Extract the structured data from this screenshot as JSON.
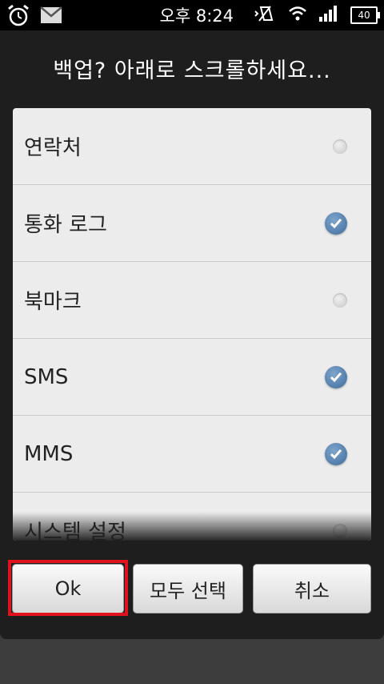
{
  "statusbar": {
    "time": "오후 8:24",
    "battery": "40",
    "left_icons": [
      "alarm-icon",
      "gmail-icon"
    ],
    "right_icons": [
      "vibrate-off-icon",
      "wifi-icon",
      "signal-icon",
      "battery-icon"
    ]
  },
  "dialog": {
    "title": "백업? 아래로 스크롤하세요..."
  },
  "items": [
    {
      "label": "연락처",
      "checked": false
    },
    {
      "label": "통화 로그",
      "checked": true
    },
    {
      "label": "북마크",
      "checked": false
    },
    {
      "label": "SMS",
      "checked": true
    },
    {
      "label": "MMS",
      "checked": true
    },
    {
      "label": "시스템 설정",
      "checked": false
    }
  ],
  "buttons": {
    "ok": "Ok",
    "select_all": "모두 선택",
    "cancel": "취소"
  },
  "colors": {
    "highlight": "#e0121e",
    "check_on": "#4a78a8"
  }
}
